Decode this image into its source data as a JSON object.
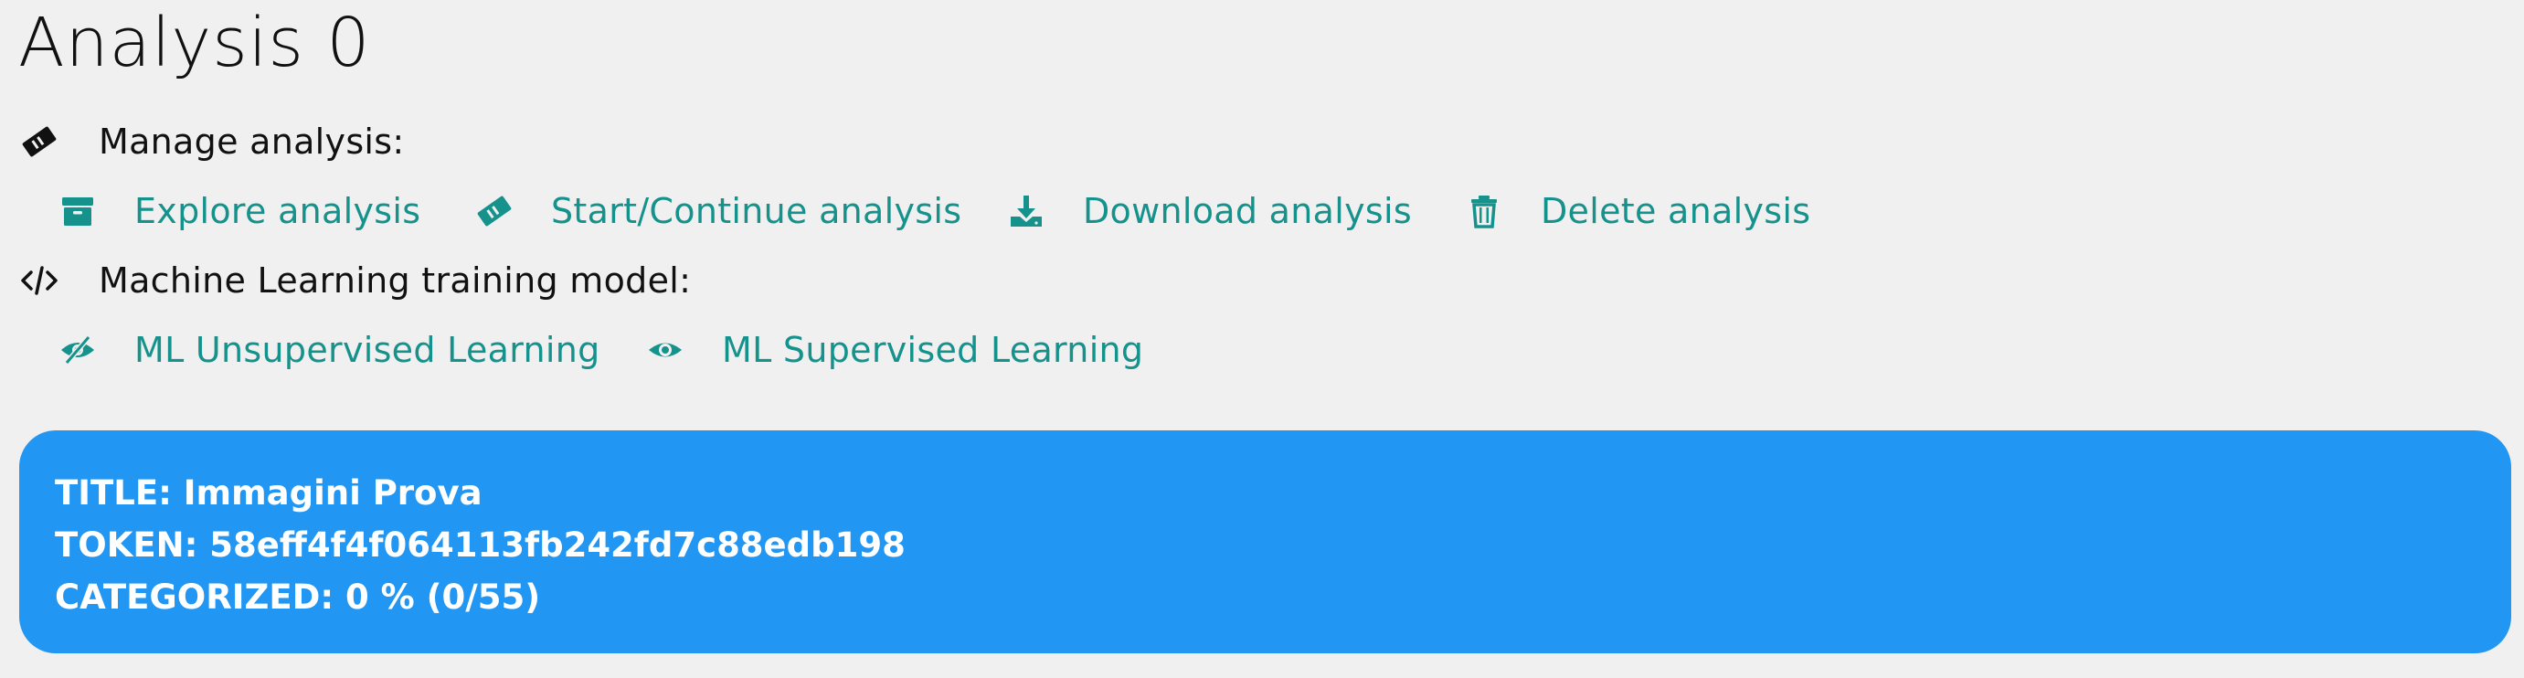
{
  "page": {
    "title": "Analysis 0"
  },
  "manage": {
    "label": "Manage analysis:",
    "icon": "ticket-icon",
    "links": [
      {
        "label": "Explore analysis",
        "icon": "archive-icon"
      },
      {
        "label": "Start/Continue analysis",
        "icon": "ticket-icon"
      },
      {
        "label": "Download analysis",
        "icon": "download-icon"
      },
      {
        "label": "Delete analysis",
        "icon": "trash-icon"
      }
    ]
  },
  "ml": {
    "label": "Machine Learning training model:",
    "icon": "code-icon",
    "links": [
      {
        "label": "ML Unsupervised Learning",
        "icon": "eye-slash-icon"
      },
      {
        "label": "ML Supervised Learning",
        "icon": "eye-icon"
      }
    ]
  },
  "info": {
    "title_line": "TITLE: Immagini Prova",
    "token_line": "TOKEN: 58eff4f4f064113fb242fd7c88edb198",
    "categorized_line": "CATEGORIZED: 0 % (0/55)"
  },
  "colors": {
    "background": "#f0f0f0",
    "link": "#15928c",
    "info_box": "#2196f3",
    "text": "#111111"
  }
}
